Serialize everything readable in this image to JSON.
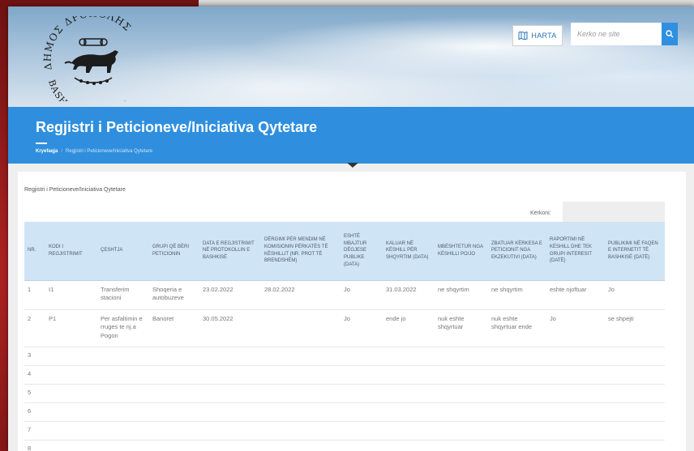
{
  "header": {
    "logo_text_top": "ΔΗΜΟΣ ΔΡΟΠΟΛΗΣ",
    "logo_text_bottom": "BASHKIA DROPULL",
    "map_label": "HARTA",
    "search_placeholder": "Kerko ne site"
  },
  "title_band": {
    "title": "Regjistri i Peticioneve/Iniciativa Qytetare",
    "breadcrumb_home": "Kryefaqja",
    "breadcrumb_separator": "/",
    "breadcrumb_current": "Regjistri i Peticioneve/Iniciativa Qytetare"
  },
  "content": {
    "section_label": "Regjistri i Peticioneve/Iniciativa Qytetare",
    "search_label": "Kërkoni:"
  },
  "table": {
    "headers": [
      "NR.",
      "KODI I REGJISTRIMIT",
      "ÇESHTJA",
      "GRUPI QË BËRI PETICIONIN",
      "DATA E REGJISTRIMIT NË PROTOKOLLIN E BASHKISË",
      "DËRGIMI PËR MENDIM NË KOMISIONIN PËRKATËS TË KËSHILLIT (NR. PROT TË BRENDSHËM)",
      "ESHTË MBAJTUR DËGJESE PUBLIKE (DATA)",
      "KALUAR NË KËSHILL PËR SHQYRTIM (DATA)",
      "MBËSHTETUR NGA KËSHILLI PO/JO",
      "ZBATUAR KËRKESA E PETICIONIT NGA EKZEKUTIVI (DATA)",
      "RAPORTIMI NË KËSHILL DHE TEK GRUPI INTERESIT (DATË)",
      "PUBLIKIMI NË FAQEN E INTERNETIT TË BASHKISË (DATË)"
    ],
    "rows": [
      [
        "1",
        "I1",
        "Transferim stacioni",
        "Shoqeria e autobuzeve",
        "23.02.2022",
        "28.02.2022",
        "Jo",
        "31.03.2022",
        "ne shqyrtim",
        "ne shqyrtim",
        "eshte njoftuar",
        "Jo"
      ],
      [
        "2",
        "P1",
        "Per asfaltimin e rruges te nj.a Pogon",
        "Banoret",
        "30.05.2022",
        "",
        "Jo",
        "ende jo",
        "nuk eshte shqyrtuar",
        "nuk eshte shqyrtuar ende",
        "Jo",
        "se shpejti"
      ],
      [
        "3",
        "",
        "",
        "",
        "",
        "",
        "",
        "",
        "",
        "",
        "",
        ""
      ],
      [
        "4",
        "",
        "",
        "",
        "",
        "",
        "",
        "",
        "",
        "",
        "",
        ""
      ],
      [
        "5",
        "",
        "",
        "",
        "",
        "",
        "",
        "",
        "",
        "",
        "",
        ""
      ],
      [
        "6",
        "",
        "",
        "",
        "",
        "",
        "",
        "",
        "",
        "",
        "",
        ""
      ],
      [
        "7",
        "",
        "",
        "",
        "",
        "",
        "",
        "",
        "",
        "",
        "",
        ""
      ],
      [
        "8",
        "",
        "",
        "",
        "",
        "",
        "",
        "",
        "",
        "",
        "",
        ""
      ]
    ]
  },
  "colors": {
    "title_band": "#2f8fde",
    "table_header": "#cfe4f5",
    "frame": "#8b1c1c"
  }
}
